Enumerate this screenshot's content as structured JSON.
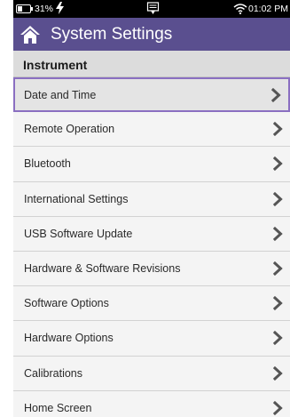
{
  "status_bar": {
    "battery_percent": 0.31,
    "battery_text": "31%",
    "time": "01:02 PM"
  },
  "header": {
    "title": "System Settings"
  },
  "section": {
    "label": "Instrument"
  },
  "menu": {
    "selected_index": 0,
    "items": [
      {
        "label": "Date and Time"
      },
      {
        "label": "Remote Operation"
      },
      {
        "label": "Bluetooth"
      },
      {
        "label": "International Settings"
      },
      {
        "label": "USB Software Update"
      },
      {
        "label": "Hardware & Software Revisions"
      },
      {
        "label": "Software Options"
      },
      {
        "label": "Hardware Options"
      },
      {
        "label": "Calibrations"
      },
      {
        "label": "Home Screen"
      }
    ]
  },
  "colors": {
    "title_bar": "#5a4f8f",
    "selection_border": "#8a6fc1",
    "status_bar": "#000000"
  }
}
